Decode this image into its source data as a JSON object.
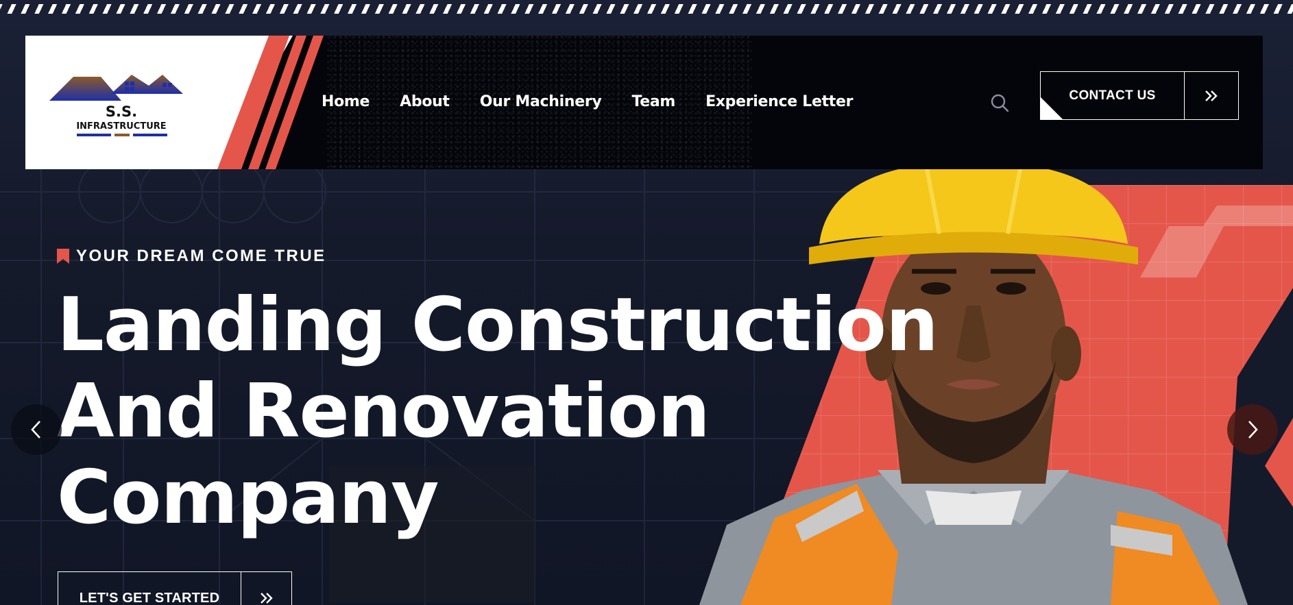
{
  "brand": {
    "logo_text_line1": "S.S.",
    "logo_text_line2": "INFRASTRUCTURE"
  },
  "nav": {
    "items": [
      {
        "label": "Home"
      },
      {
        "label": "About"
      },
      {
        "label": "Our Machinery"
      },
      {
        "label": "Team"
      },
      {
        "label": "Experience Letter"
      }
    ]
  },
  "header": {
    "search_icon": "search-icon",
    "contact_label": "CONTACT US",
    "contact_icon": "double-chevron-right-icon"
  },
  "hero": {
    "tagline": "YOUR DREAM COME TRUE",
    "headline_line1": "Landing Construction",
    "headline_line2": "And Renovation",
    "headline_line3": "Company",
    "cta_label": "LET'S GET STARTED",
    "cta_icon": "double-chevron-right-icon",
    "prev_icon": "chevron-left-icon",
    "next_icon": "chevron-right-icon"
  },
  "colors": {
    "accent": "#e5564a",
    "dark": "#04050a",
    "background": "#151a2b",
    "brand_blue": "#1f2fa8",
    "brand_brown": "#8a5a2b"
  }
}
